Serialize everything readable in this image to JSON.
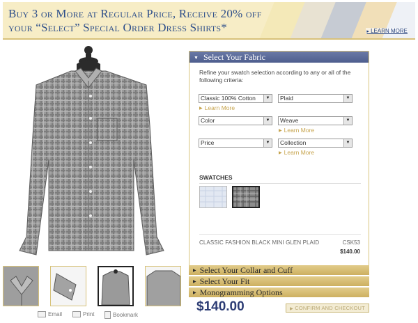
{
  "banner": {
    "line1": "Buy 3 or More at Regular Price, Receive 20% off",
    "line2": "your “Select” Special Order Dress Shirts*",
    "learn_more": "LEARN MORE",
    "swatch_colors": [
      "#f4e9b8",
      "#e8e2d2",
      "#c6cbd3",
      "#f1dfb8",
      "#eef1f6"
    ]
  },
  "thumbs": {
    "count": 4
  },
  "share": {
    "email": "Email",
    "print": "Print",
    "bookmark": "Bookmark"
  },
  "fabric_panel": {
    "title": "Select Your Fabric",
    "intro": "Refine your swatch selection according to any or all of the following criteria:",
    "selects": {
      "fabric": "Classic 100% Cotton",
      "pattern": "Plaid",
      "color": "Color",
      "weave": "Weave",
      "price": "Price",
      "collection": "Collection"
    },
    "learn_more": "Learn More",
    "swatches_title": "SWATCHES",
    "product_name": "CLASSIC FASHION BLACK MINI GLEN PLAID",
    "product_code": "CSK53",
    "product_price": "$140.00"
  },
  "accordion": {
    "collar": "Select Your Collar and Cuff",
    "fit": "Select Your Fit",
    "monogram": "Monogramming Options"
  },
  "footer": {
    "total": "$140.00",
    "confirm": "CONFIRM AND CHECKOUT"
  },
  "colors": {
    "banner_text": "#2e4f8a",
    "panel_header": "#5a6a98",
    "accordion": "#d4b86c",
    "total": "#2d3d75",
    "learn_more": "#c6a34c"
  }
}
